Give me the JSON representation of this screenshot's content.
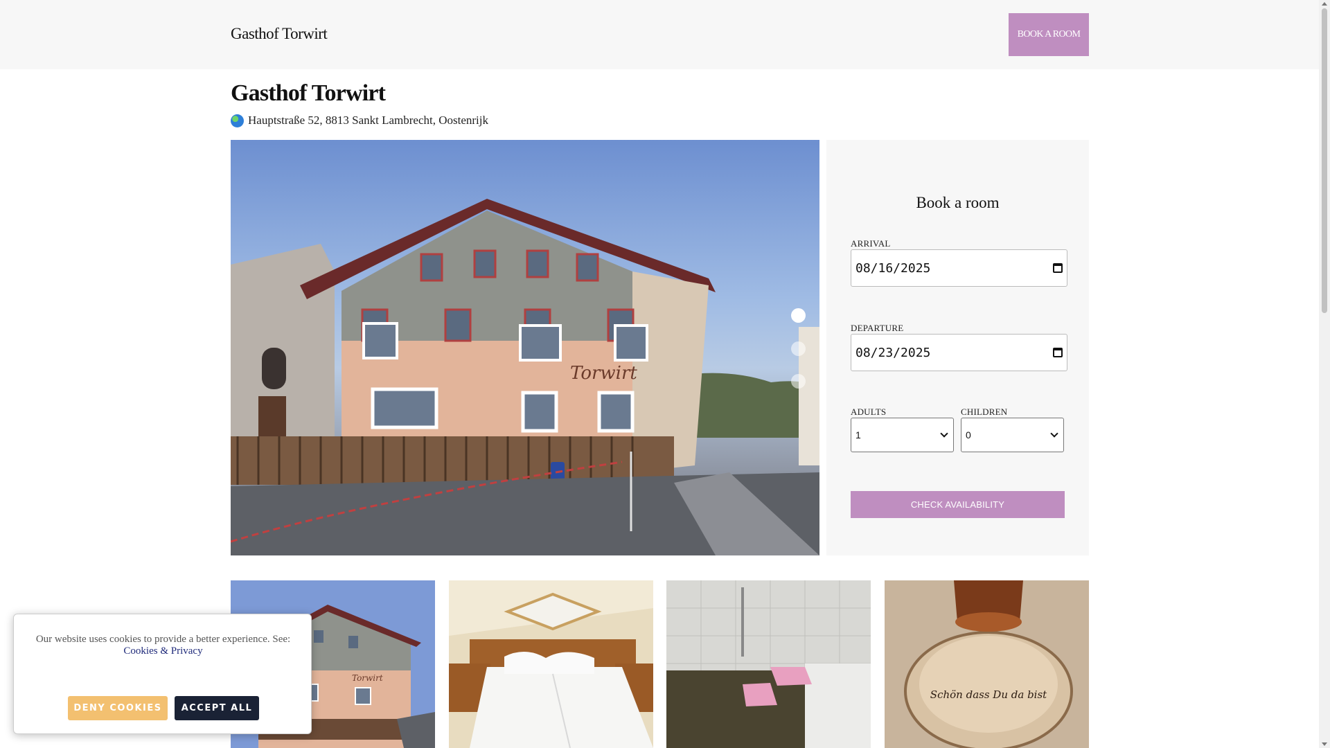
{
  "header": {
    "brand": "Gasthof Torwirt",
    "book_button": "BOOK A ROOM"
  },
  "hotel": {
    "name": "Gasthof Torwirt",
    "address": "Hauptstraße 52, 8813 Sankt Lambrecht, Oostenrijk",
    "address_icon": "globe-icon",
    "facade_sign": "Torwirt"
  },
  "carousel": {
    "slide_count": 3,
    "active_slide": 1
  },
  "booking": {
    "title": "Book a room",
    "arrival_label": "ARRIVAL",
    "arrival_value": "08/16/2025",
    "departure_label": "DEPARTURE",
    "departure_value": "08/23/2025",
    "adults_label": "ADULTS",
    "adults_value": "1",
    "children_label": "CHILDREN",
    "children_value": "0",
    "check_button": "CHECK AVAILABILITY"
  },
  "thumb_text": {
    "coaster": "Schön dass Du da bist"
  },
  "cookie_banner": {
    "text": "Our website uses cookies to provide a better experience. See:",
    "link": "Cookies & Privacy",
    "deny_button": "DENY COOKIES",
    "accept_button": "ACCEPT ALL"
  },
  "colors": {
    "accent": "#bf8ec0",
    "deny": "#f3c070",
    "accept": "#1a2235",
    "header_bg": "#f7f7f7"
  }
}
